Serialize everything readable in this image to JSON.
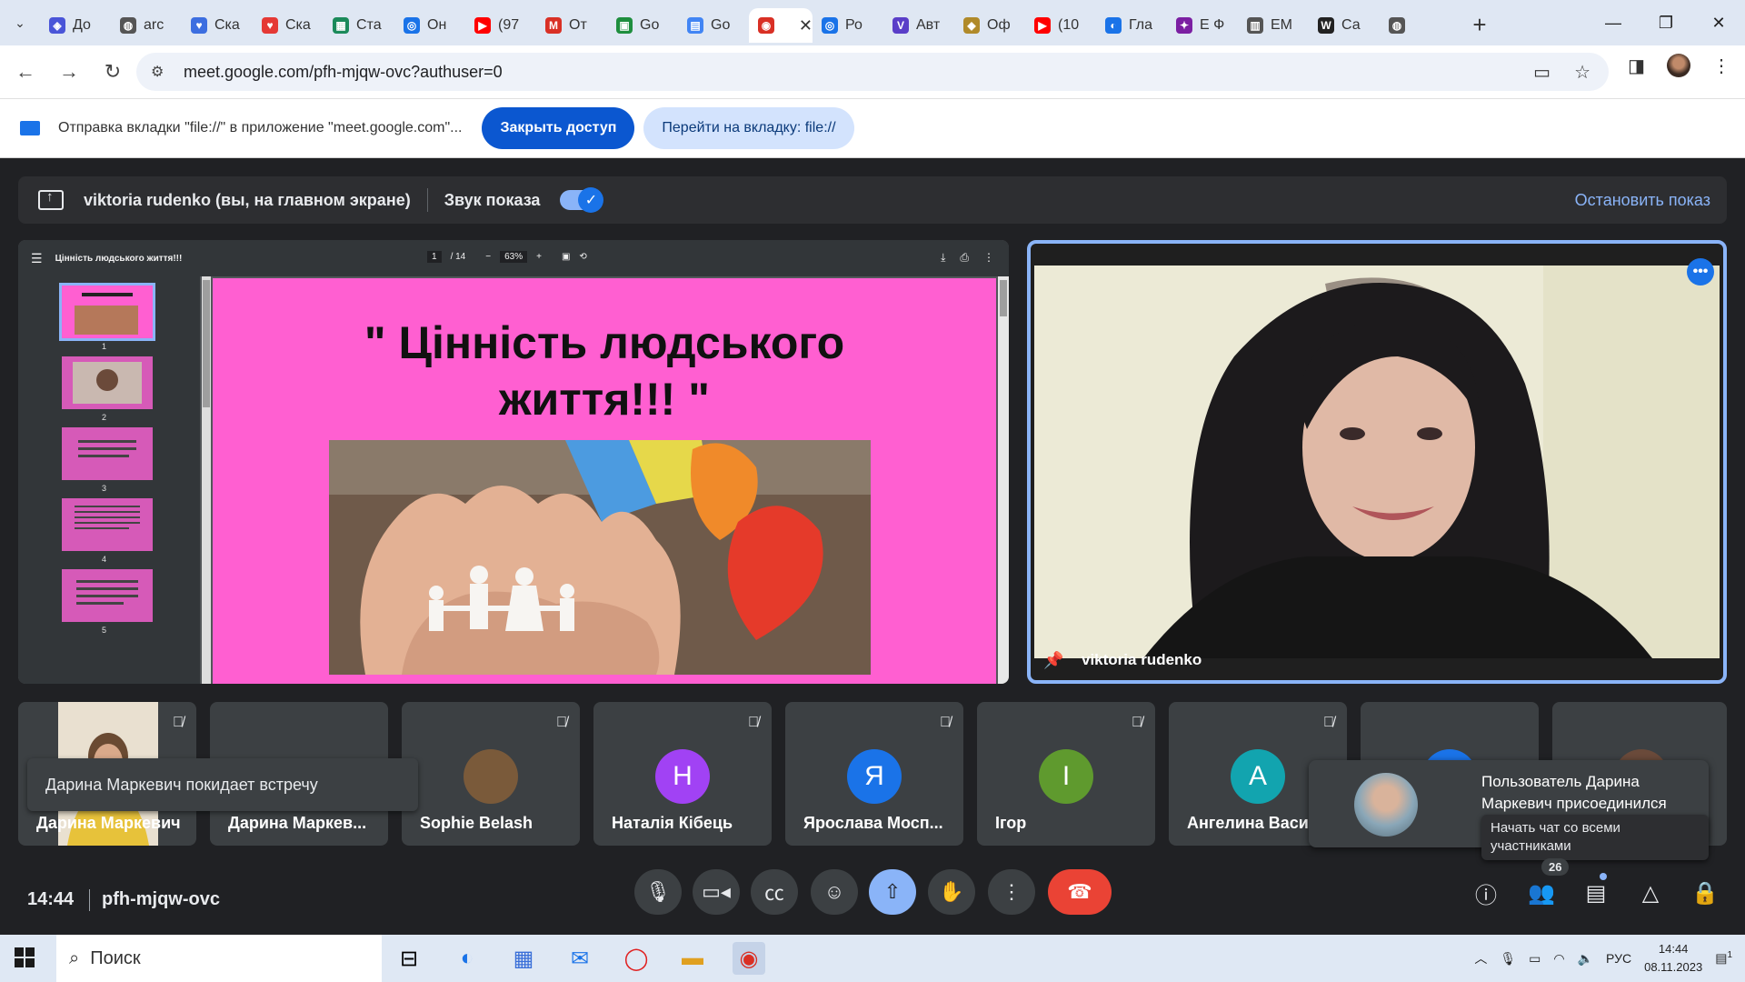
{
  "browser": {
    "tabs": [
      {
        "title": "До",
        "icon": "shield-icon",
        "color": "#4a55d8"
      },
      {
        "title": "arc",
        "icon": "globe-icon",
        "color": "#555555"
      },
      {
        "title": "Ска",
        "icon": "heart-icon",
        "color": "#3c6ee0"
      },
      {
        "title": "Ска",
        "icon": "heart-icon",
        "color": "#e53935"
      },
      {
        "title": "Ста",
        "icon": "sheets-icon",
        "color": "#1b8a5a"
      },
      {
        "title": "Он",
        "icon": "target-icon",
        "color": "#1a73e8"
      },
      {
        "title": "(97",
        "icon": "youtube-icon",
        "color": "#ff0000"
      },
      {
        "title": "От",
        "icon": "gmail-icon",
        "color": "#d93025"
      },
      {
        "title": "Go",
        "icon": "classroom-icon",
        "color": "#1e8e3e"
      },
      {
        "title": "Go",
        "icon": "docs-icon",
        "color": "#4285f4"
      },
      {
        "title": "",
        "icon": "record-icon",
        "color": "#d93025"
      },
      {
        "title": "Ро",
        "icon": "target-icon",
        "color": "#1a73e8"
      },
      {
        "title": "Авт",
        "icon": "vk-icon",
        "color": "#5a3ec8"
      },
      {
        "title": "Оф",
        "icon": "crest-icon",
        "color": "#b08a2a"
      },
      {
        "title": "(10",
        "icon": "youtube-icon",
        "color": "#ff0000"
      },
      {
        "title": "Гла",
        "icon": "edge-icon",
        "color": "#1a73e8"
      },
      {
        "title": "Е Ф",
        "icon": "puzzle-icon",
        "color": "#7b1fa2"
      },
      {
        "title": "ЕМ",
        "icon": "doc-icon",
        "color": "#555555"
      },
      {
        "title": "Са",
        "icon": "wikipedia-icon",
        "color": "#222222"
      },
      {
        "title": "",
        "icon": "globe-icon",
        "color": "#555555"
      }
    ],
    "url": "meet.google.com/pfh-mjqw-ovc?authuser=0"
  },
  "infobar": {
    "message": "Отправка вкладки \"file://\" в приложение \"meet.google.com\"...",
    "stop_access": "Закрыть доступ",
    "go_to_tab": "Перейти на вкладку: file://"
  },
  "presenting": {
    "name": "viktoria rudenko (вы, на главном экране)",
    "audio_label": "Звук показа",
    "audio_on": true,
    "stop_label": "Остановить показ"
  },
  "pdf": {
    "title": "Цінність людського життя!!!",
    "page": "1",
    "page_total": "/ 14",
    "zoom": "63%",
    "thumb_labels": [
      "1",
      "2",
      "3",
      "4",
      "5"
    ],
    "slide_title_line1": "\" Цінність людського",
    "slide_title_line2": "життя!!! \""
  },
  "speaker": {
    "name": "viktoria rudenko"
  },
  "participants": [
    {
      "name": "Дарина Маркевич",
      "initial": "",
      "color": "#c9a24a"
    },
    {
      "name": "Дарина Маркев...",
      "initial": "",
      "color": "#3c4043"
    },
    {
      "name": "Sophie Belash",
      "initial": "",
      "color": "#7a5a3a"
    },
    {
      "name": "Наталія Кібець",
      "initial": "Н",
      "color": "#a142f4"
    },
    {
      "name": "Ярослава Мосп...",
      "initial": "Я",
      "color": "#1a73e8"
    },
    {
      "name": "Ігор",
      "initial": "І",
      "color": "#5f9a2e"
    },
    {
      "name": "Ангелина Васил",
      "initial": "А",
      "color": "#12a4af"
    },
    {
      "name": "",
      "initial": "",
      "color": "#1a73e8"
    },
    {
      "name": "",
      "initial": "",
      "color": "#6a4a3a"
    }
  ],
  "toasts": {
    "leave": "Дарина Маркевич покидает встречу",
    "join": "Пользователь Дарина Маркевич присоединился",
    "chat": "Начать чат со всеми участниками"
  },
  "controls": {
    "time": "14:44",
    "meeting_code": "pfh-mjqw-ovc",
    "people_count": "26"
  },
  "taskbar": {
    "search_placeholder": "Поиск",
    "lang": "РУС",
    "time": "14:44",
    "date": "08.11.2023",
    "notifications": "1"
  }
}
